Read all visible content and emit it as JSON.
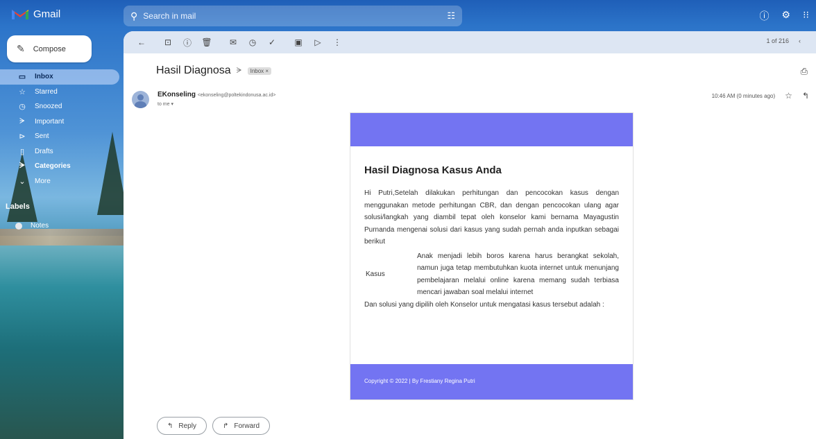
{
  "app": {
    "name": "Gmail"
  },
  "search": {
    "placeholder": "Search in mail"
  },
  "compose": {
    "label": "Compose"
  },
  "nav": [
    {
      "label": "Inbox",
      "icon": "inbox-icon",
      "glyph": "▭"
    },
    {
      "label": "Starred",
      "icon": "star-icon",
      "glyph": "☆"
    },
    {
      "label": "Snoozed",
      "icon": "clock-icon",
      "glyph": "◷"
    },
    {
      "label": "Important",
      "icon": "important-icon",
      "glyph": "ᗒ"
    },
    {
      "label": "Sent",
      "icon": "send-icon",
      "glyph": "⊳"
    },
    {
      "label": "Drafts",
      "icon": "draft-icon",
      "glyph": "▯"
    },
    {
      "label": "Categories",
      "icon": "label-icon",
      "glyph": "ᗒ"
    },
    {
      "label": "More",
      "icon": "chevron-down-icon",
      "glyph": "⌄"
    }
  ],
  "labels": {
    "title": "Labels",
    "items": [
      {
        "label": "Notes"
      }
    ]
  },
  "toolbar": {
    "pager": "1 of 216"
  },
  "email": {
    "subject": "Hasil Diagnosa",
    "chip": "Inbox ×",
    "sender_name": "EKonseling",
    "sender_email": "<ekonseling@poltekindonusa.ac.id>",
    "to": "to me ▾",
    "time": "10:46 AM (0 minutes ago)"
  },
  "card": {
    "title": "Hasil Diagnosa Kasus Anda",
    "intro": "Hi Putri,Setelah dilakukan perhitungan dan pencocokan kasus dengan menggunakan metode perhitungan CBR, dan dengan pencocokan ulang agar solusi/langkah yang diambil tepat oleh konselor kami bernama Mayagustin Purnanda mengenai solusi dari kasus yang sudah pernah anda inputkan sebagai berikut",
    "kasus_label": "Kasus",
    "kasus_text": "Anak menjadi lebih boros karena harus berangkat sekolah, namun juga tetap membutuhkan kuota internet untuk menunjang pembelajaran melalui online karena memang sudah terbiasa mencari jawaban soal melalui internet",
    "solution": "Dan solusi yang dipilih oleh Konselor untuk mengatasi kasus tersebut adalah :",
    "footer": "Copyright © 2022 | By Frestiany Regina Putri",
    "accent": "#7374f2"
  },
  "actions": {
    "reply": "Reply",
    "forward": "Forward"
  }
}
